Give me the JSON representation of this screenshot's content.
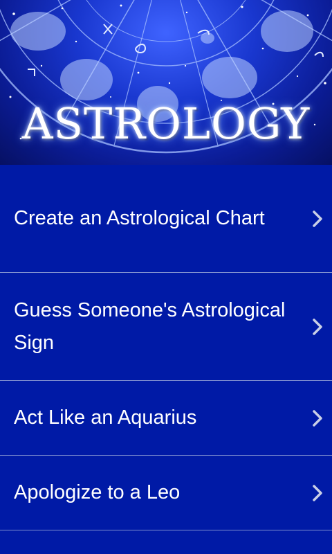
{
  "header": {
    "title": "ASTROLOGY"
  },
  "menu": {
    "items": [
      {
        "label": "Create an Astrological Chart"
      },
      {
        "label": "Guess Someone's Astrological Sign"
      },
      {
        "label": "Act Like an Aquarius"
      },
      {
        "label": "Apologize to a Leo"
      }
    ]
  },
  "icons": {
    "chevron": "chevron-right-icon"
  },
  "colors": {
    "menu_background": "#001aa6",
    "divider": "#7f8fcf",
    "text": "#ffffff",
    "chevron": "#c9cfe6"
  }
}
